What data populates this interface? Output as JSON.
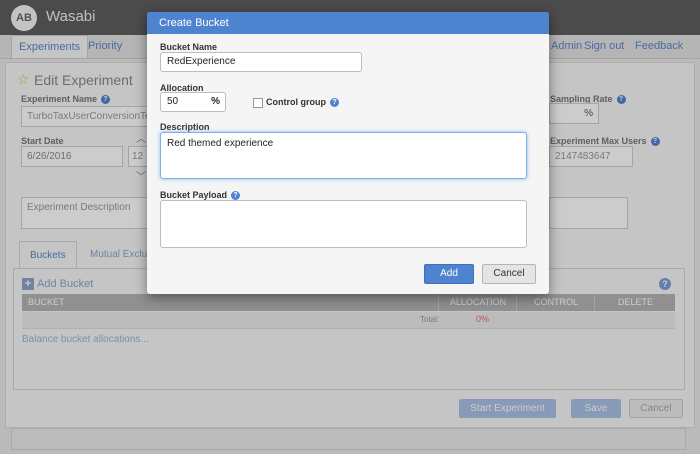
{
  "app": {
    "logo": "AB",
    "name": "Wasabi"
  },
  "nav": {
    "items": [
      "Experiments",
      "Priority"
    ],
    "right": [
      "Admin",
      "Sign out",
      "Feedback"
    ]
  },
  "page": {
    "title": "Edit Experiment",
    "experiment_name_label": "Experiment Name",
    "experiment_name_value": "TurboTaxUserConversionTes",
    "sampling_rate_label": "Sampling Rate",
    "sampling_unit": "%",
    "start_date_label": "Start Date",
    "start_date_value": "6/26/2016",
    "start_time_value": "12",
    "max_users_label": "Experiment Max Users",
    "max_users_value": "2147483647",
    "description_placeholder": "Experiment Description",
    "tabs": [
      "Buckets",
      "Mutual Exclu"
    ],
    "add_bucket_label": "Add Bucket",
    "table_headers": [
      "BUCKET",
      "ALLOCATION",
      "CONTROL",
      "DELETE"
    ],
    "total_label": "Total:",
    "total_value": "0%",
    "balance_link": "Balance bucket allocations...",
    "buttons": {
      "start": "Start Experiment",
      "save": "Save",
      "cancel": "Cancel"
    }
  },
  "modal": {
    "title": "Create Bucket",
    "bucket_name_label": "Bucket Name",
    "bucket_name_value": "RedExperience",
    "allocation_label": "Allocation",
    "allocation_value": "50",
    "allocation_unit": "%",
    "control_group_label": "Control group",
    "description_label": "Description",
    "description_value": "Red themed experience",
    "payload_label": "Bucket Payload",
    "add_button": "Add",
    "cancel_button": "Cancel"
  },
  "colors": {
    "accent": "#4e84cf",
    "topbar": "#5e5e5e",
    "total_value": "#e86c6c"
  }
}
